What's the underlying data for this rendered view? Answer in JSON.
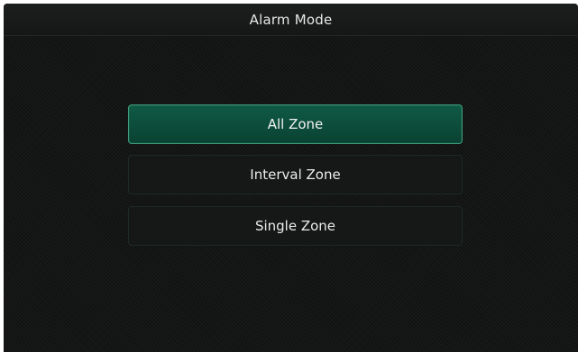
{
  "window": {
    "title": "Alarm Mode"
  },
  "options": [
    {
      "label": "All Zone",
      "selected": true
    },
    {
      "label": "Interval Zone",
      "selected": false
    },
    {
      "label": "Single Zone",
      "selected": false
    }
  ],
  "colors": {
    "background": "#141615",
    "selected_fill": "#0f5a45",
    "selected_border": "#3f9c7a",
    "text": "#ececec"
  }
}
